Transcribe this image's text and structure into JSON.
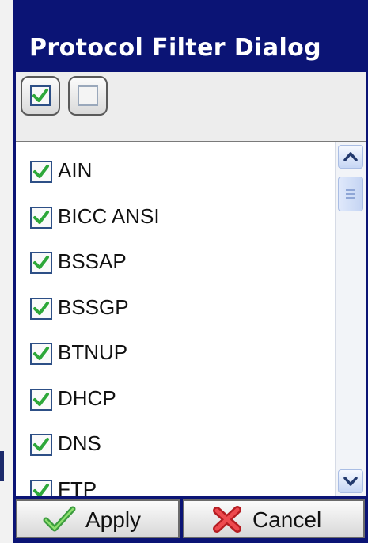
{
  "window": {
    "title": "Protocol Filter Dialog"
  },
  "toolbar": {
    "select_all_icon": "checked-box-icon",
    "select_none_icon": "empty-box-icon"
  },
  "protocols": [
    {
      "label": "AIN",
      "checked": true
    },
    {
      "label": "BICC ANSI",
      "checked": true
    },
    {
      "label": "BSSAP",
      "checked": true
    },
    {
      "label": "BSSGP",
      "checked": true
    },
    {
      "label": "BTNUP",
      "checked": true
    },
    {
      "label": "DHCP",
      "checked": true
    },
    {
      "label": "DNS",
      "checked": true
    },
    {
      "label": "FTP",
      "checked": true
    }
  ],
  "actions": {
    "apply_label": "Apply",
    "apply_icon": "checkmark-icon",
    "cancel_label": "Cancel",
    "cancel_icon": "red-x-icon"
  },
  "colors": {
    "title_bar": "#0b1475",
    "check_green": "#2ea83a",
    "checkbox_border": "#2d4f86",
    "cancel_red": "#d8262b"
  }
}
